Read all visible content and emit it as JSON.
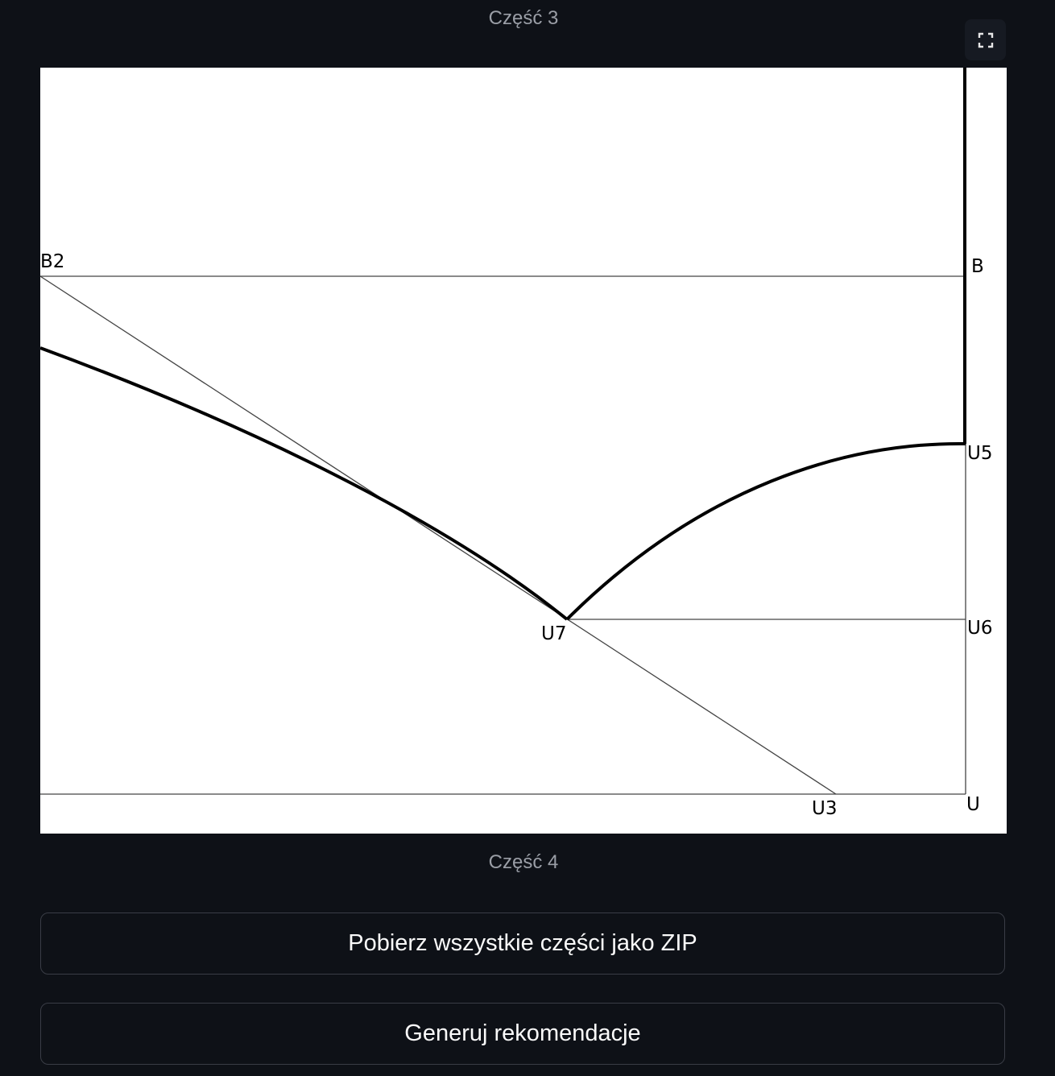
{
  "captions": {
    "top": "Część 3",
    "bottom": "Część 4"
  },
  "toolbar": {
    "fullscreen_icon": "fullscreen-icon"
  },
  "figure": {
    "points": {
      "B2": "B2",
      "B": "B",
      "U5": "U5",
      "U6": "U6",
      "U7": "U7",
      "U3": "U3",
      "U": "U"
    }
  },
  "buttons": {
    "download_zip": "Pobierz wszystkie części jako ZIP",
    "generate": "Generuj rekomendacje"
  },
  "colors": {
    "background": "#0e1117",
    "caption": "#9a9ea6",
    "button_border": "#3a3d46",
    "button_text": "#fafafa"
  }
}
